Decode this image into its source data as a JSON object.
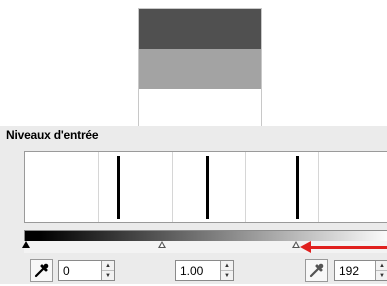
{
  "preview": {
    "swatches": [
      {
        "name": "dark-grey",
        "color": "#505050"
      },
      {
        "name": "mid-grey",
        "color": "#a3a3a3"
      },
      {
        "name": "white",
        "color": "#ffffff"
      }
    ]
  },
  "levels": {
    "title": "Niveaux d'entrée",
    "black_input": {
      "value": "0"
    },
    "gamma_input": {
      "value": "1.00"
    },
    "white_input": {
      "value": "192"
    }
  },
  "icons": {
    "black_picker": "eyedropper-icon",
    "white_picker": "eyedropper-icon",
    "annotation": "red-arrow-icon"
  },
  "colors": {
    "panel_bg": "#ebebeb",
    "accent_arrow": "#e0201e"
  }
}
